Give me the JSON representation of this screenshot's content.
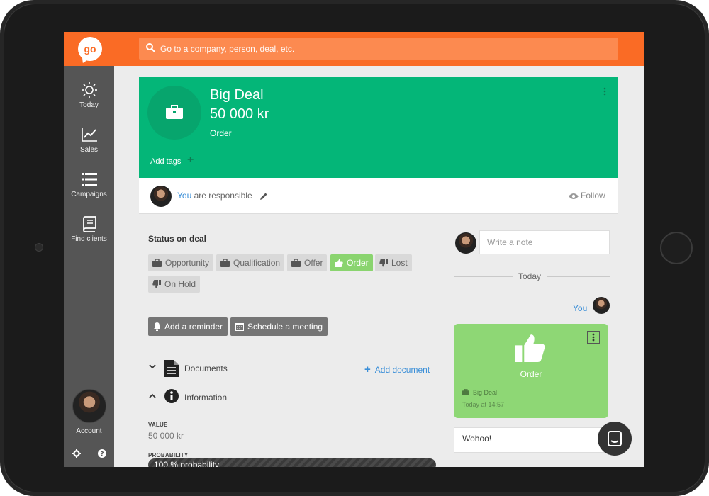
{
  "app": {
    "logo_text": "go",
    "accent": "#fa6b25",
    "deal_green": "#04b678"
  },
  "search": {
    "placeholder": "Go to a company, person, deal, etc."
  },
  "sidebar": {
    "items": [
      {
        "label": "Today",
        "icon": "sun-icon"
      },
      {
        "label": "Sales",
        "icon": "chart-line-icon"
      },
      {
        "label": "Campaigns",
        "icon": "list-icon"
      },
      {
        "label": "Find clients",
        "icon": "book-icon"
      }
    ],
    "account_label": "Account"
  },
  "deal": {
    "title": "Big Deal",
    "value": "50 000 kr",
    "stage": "Order",
    "add_tags": "Add tags"
  },
  "responsible": {
    "you": "You",
    "text": " are responsible",
    "follow": "Follow"
  },
  "status": {
    "title": "Status on deal",
    "chips": [
      {
        "label": "Opportunity",
        "icon": "briefcase-icon"
      },
      {
        "label": "Qualification",
        "icon": "briefcase-icon"
      },
      {
        "label": "Offer",
        "icon": "briefcase-icon"
      },
      {
        "label": "Order",
        "icon": "thumbs-up-icon",
        "active": true
      },
      {
        "label": "Lost",
        "icon": "thumbs-down-icon"
      },
      {
        "label": "On Hold",
        "icon": "thumbs-down-icon"
      }
    ]
  },
  "actions": {
    "reminder": "Add a reminder",
    "meeting": "Schedule a meeting"
  },
  "sections": {
    "documents": "Documents",
    "add_document": "Add document",
    "information": "Information"
  },
  "info": {
    "value_label": "VALUE",
    "value": "50 000 kr",
    "probability_label": "PROBABILITY",
    "probability_text": "100 % probability",
    "probability": 100
  },
  "feed": {
    "note_placeholder": "Write a note",
    "today": "Today",
    "author": "You",
    "card_title": "Order",
    "deal_ref": "Big Deal",
    "time": "Today at 14:57",
    "comment": "Wohoo!"
  }
}
